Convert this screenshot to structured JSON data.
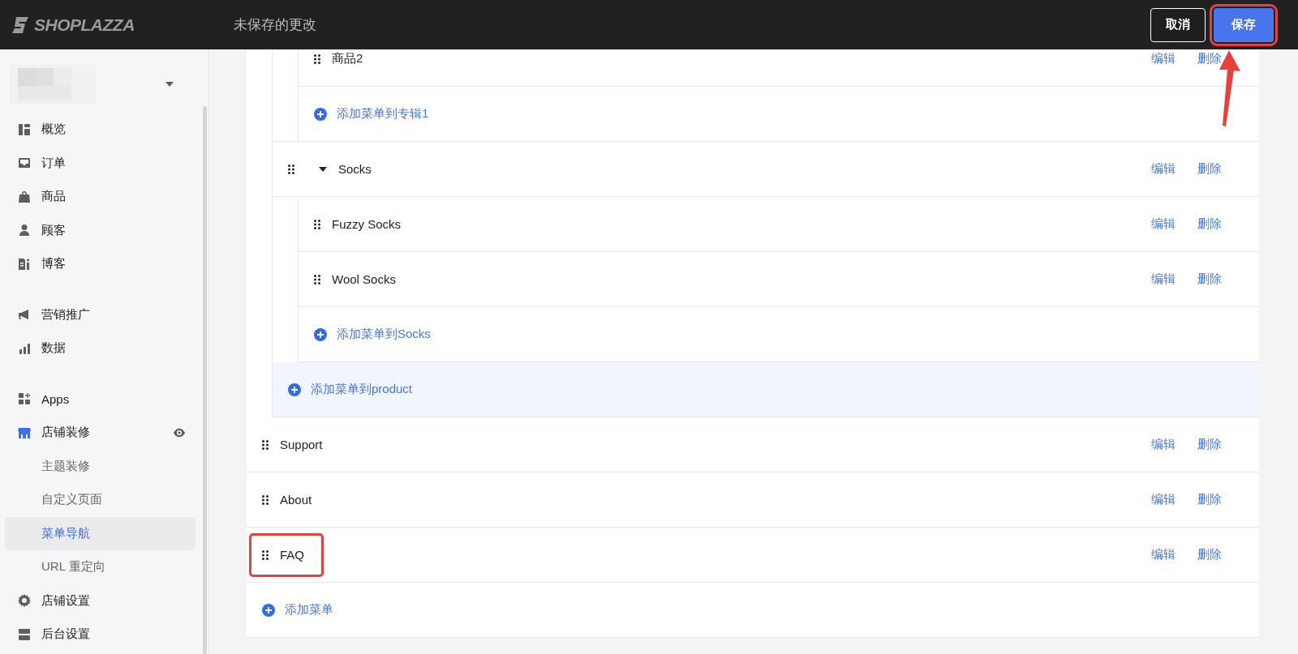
{
  "header": {
    "logo": "SHOPLAZZA",
    "title": "未保存的更改",
    "buttons": [
      {
        "label": "取消",
        "kind": "secondary",
        "annotated": false
      },
      {
        "label": "保存",
        "kind": "primary",
        "annotated": true
      }
    ]
  },
  "sidebar": {
    "groups": [
      {
        "items": [
          {
            "label": "概览",
            "selected": false
          },
          {
            "label": "订单",
            "selected": false
          },
          {
            "label": "商品",
            "selected": false
          },
          {
            "label": "顾客",
            "selected": false
          },
          {
            "label": "博客",
            "selected": false
          }
        ]
      },
      {
        "items": [
          {
            "label": "营销推广",
            "selected": false
          },
          {
            "label": "数据",
            "selected": false
          }
        ]
      },
      {
        "items": [
          {
            "label": "Apps",
            "selected": false
          },
          {
            "label": "店铺装修",
            "selected": false,
            "expanded": true,
            "children": [
              {
                "label": "主题装修",
                "selected": false
              },
              {
                "label": "自定义页面",
                "selected": false
              },
              {
                "label": "菜单导航",
                "selected": true
              },
              {
                "label": "URL 重定向",
                "selected": false
              }
            ]
          },
          {
            "label": "店铺设置",
            "selected": false
          },
          {
            "label": "后台设置",
            "selected": false
          }
        ]
      }
    ]
  },
  "menu": {
    "items": [
      {
        "expanded": true,
        "children": [
          {
            "expanded": true,
            "children": [
              {
                "label": "商品2",
                "edit": "编辑",
                "delete": "删除",
                "annotated": false
              }
            ],
            "add": {
              "label": "添加菜单到专辑1",
              "highlighted": false
            }
          },
          {
            "label": "Socks",
            "expanded": true,
            "edit": "编辑",
            "delete": "删除",
            "annotated": false,
            "children": [
              {
                "label": "Fuzzy Socks",
                "edit": "编辑",
                "delete": "删除",
                "annotated": false
              },
              {
                "label": "Wool Socks",
                "edit": "编辑",
                "delete": "删除",
                "annotated": false
              }
            ],
            "add": {
              "label": "添加菜单到Socks",
              "highlighted": false
            }
          }
        ],
        "add": {
          "label": "添加菜单到product",
          "highlighted": true
        }
      },
      {
        "label": "Support",
        "edit": "编辑",
        "delete": "删除",
        "annotated": false
      },
      {
        "label": "About",
        "edit": "编辑",
        "delete": "删除",
        "annotated": false
      },
      {
        "label": "FAQ",
        "edit": "编辑",
        "delete": "删除",
        "annotated": true
      }
    ],
    "add": {
      "label": "添加菜单",
      "highlighted": false
    }
  }
}
